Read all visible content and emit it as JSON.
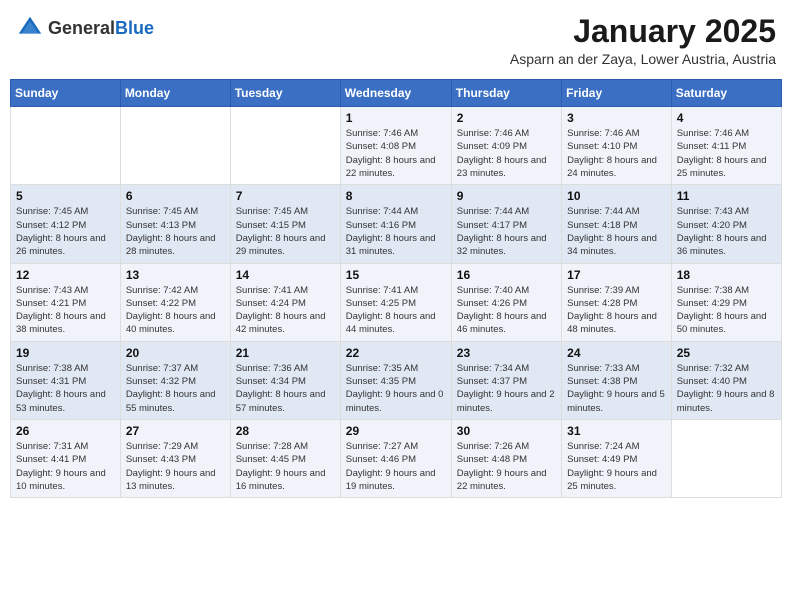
{
  "header": {
    "logo_general": "General",
    "logo_blue": "Blue",
    "month": "January 2025",
    "location": "Asparn an der Zaya, Lower Austria, Austria"
  },
  "days_of_week": [
    "Sunday",
    "Monday",
    "Tuesday",
    "Wednesday",
    "Thursday",
    "Friday",
    "Saturday"
  ],
  "weeks": [
    [
      {
        "day": "",
        "info": ""
      },
      {
        "day": "",
        "info": ""
      },
      {
        "day": "",
        "info": ""
      },
      {
        "day": "1",
        "info": "Sunrise: 7:46 AM\nSunset: 4:08 PM\nDaylight: 8 hours and 22 minutes."
      },
      {
        "day": "2",
        "info": "Sunrise: 7:46 AM\nSunset: 4:09 PM\nDaylight: 8 hours and 23 minutes."
      },
      {
        "day": "3",
        "info": "Sunrise: 7:46 AM\nSunset: 4:10 PM\nDaylight: 8 hours and 24 minutes."
      },
      {
        "day": "4",
        "info": "Sunrise: 7:46 AM\nSunset: 4:11 PM\nDaylight: 8 hours and 25 minutes."
      }
    ],
    [
      {
        "day": "5",
        "info": "Sunrise: 7:45 AM\nSunset: 4:12 PM\nDaylight: 8 hours and 26 minutes."
      },
      {
        "day": "6",
        "info": "Sunrise: 7:45 AM\nSunset: 4:13 PM\nDaylight: 8 hours and 28 minutes."
      },
      {
        "day": "7",
        "info": "Sunrise: 7:45 AM\nSunset: 4:15 PM\nDaylight: 8 hours and 29 minutes."
      },
      {
        "day": "8",
        "info": "Sunrise: 7:44 AM\nSunset: 4:16 PM\nDaylight: 8 hours and 31 minutes."
      },
      {
        "day": "9",
        "info": "Sunrise: 7:44 AM\nSunset: 4:17 PM\nDaylight: 8 hours and 32 minutes."
      },
      {
        "day": "10",
        "info": "Sunrise: 7:44 AM\nSunset: 4:18 PM\nDaylight: 8 hours and 34 minutes."
      },
      {
        "day": "11",
        "info": "Sunrise: 7:43 AM\nSunset: 4:20 PM\nDaylight: 8 hours and 36 minutes."
      }
    ],
    [
      {
        "day": "12",
        "info": "Sunrise: 7:43 AM\nSunset: 4:21 PM\nDaylight: 8 hours and 38 minutes."
      },
      {
        "day": "13",
        "info": "Sunrise: 7:42 AM\nSunset: 4:22 PM\nDaylight: 8 hours and 40 minutes."
      },
      {
        "day": "14",
        "info": "Sunrise: 7:41 AM\nSunset: 4:24 PM\nDaylight: 8 hours and 42 minutes."
      },
      {
        "day": "15",
        "info": "Sunrise: 7:41 AM\nSunset: 4:25 PM\nDaylight: 8 hours and 44 minutes."
      },
      {
        "day": "16",
        "info": "Sunrise: 7:40 AM\nSunset: 4:26 PM\nDaylight: 8 hours and 46 minutes."
      },
      {
        "day": "17",
        "info": "Sunrise: 7:39 AM\nSunset: 4:28 PM\nDaylight: 8 hours and 48 minutes."
      },
      {
        "day": "18",
        "info": "Sunrise: 7:38 AM\nSunset: 4:29 PM\nDaylight: 8 hours and 50 minutes."
      }
    ],
    [
      {
        "day": "19",
        "info": "Sunrise: 7:38 AM\nSunset: 4:31 PM\nDaylight: 8 hours and 53 minutes."
      },
      {
        "day": "20",
        "info": "Sunrise: 7:37 AM\nSunset: 4:32 PM\nDaylight: 8 hours and 55 minutes."
      },
      {
        "day": "21",
        "info": "Sunrise: 7:36 AM\nSunset: 4:34 PM\nDaylight: 8 hours and 57 minutes."
      },
      {
        "day": "22",
        "info": "Sunrise: 7:35 AM\nSunset: 4:35 PM\nDaylight: 9 hours and 0 minutes."
      },
      {
        "day": "23",
        "info": "Sunrise: 7:34 AM\nSunset: 4:37 PM\nDaylight: 9 hours and 2 minutes."
      },
      {
        "day": "24",
        "info": "Sunrise: 7:33 AM\nSunset: 4:38 PM\nDaylight: 9 hours and 5 minutes."
      },
      {
        "day": "25",
        "info": "Sunrise: 7:32 AM\nSunset: 4:40 PM\nDaylight: 9 hours and 8 minutes."
      }
    ],
    [
      {
        "day": "26",
        "info": "Sunrise: 7:31 AM\nSunset: 4:41 PM\nDaylight: 9 hours and 10 minutes."
      },
      {
        "day": "27",
        "info": "Sunrise: 7:29 AM\nSunset: 4:43 PM\nDaylight: 9 hours and 13 minutes."
      },
      {
        "day": "28",
        "info": "Sunrise: 7:28 AM\nSunset: 4:45 PM\nDaylight: 9 hours and 16 minutes."
      },
      {
        "day": "29",
        "info": "Sunrise: 7:27 AM\nSunset: 4:46 PM\nDaylight: 9 hours and 19 minutes."
      },
      {
        "day": "30",
        "info": "Sunrise: 7:26 AM\nSunset: 4:48 PM\nDaylight: 9 hours and 22 minutes."
      },
      {
        "day": "31",
        "info": "Sunrise: 7:24 AM\nSunset: 4:49 PM\nDaylight: 9 hours and 25 minutes."
      },
      {
        "day": "",
        "info": ""
      }
    ]
  ]
}
